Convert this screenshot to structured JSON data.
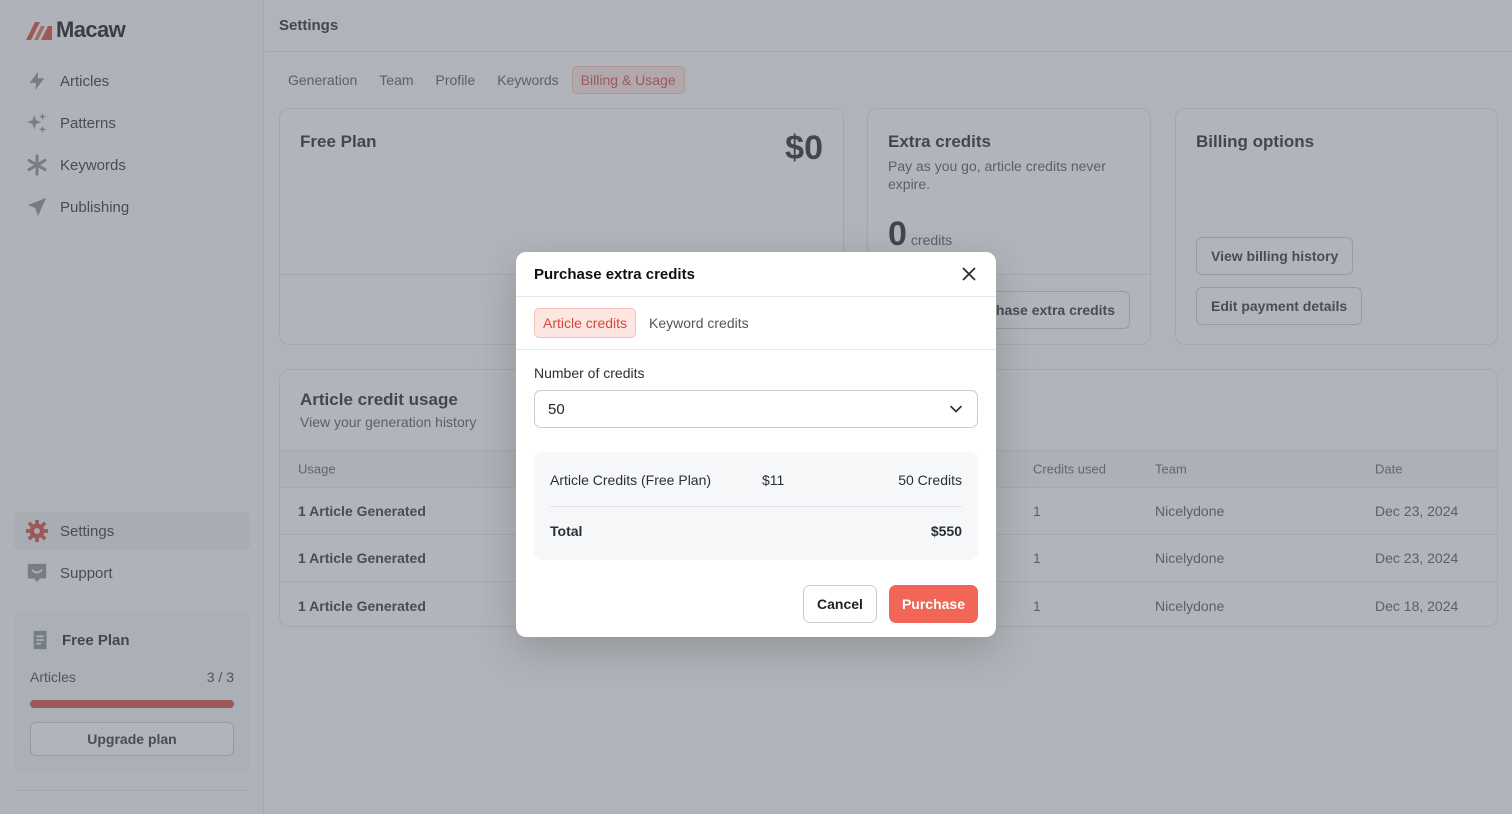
{
  "app": {
    "brand": "Macaw"
  },
  "sidebar": {
    "items": [
      {
        "label": "Articles",
        "icon": "lightning-icon"
      },
      {
        "label": "Patterns",
        "icon": "sparkles-icon"
      },
      {
        "label": "Keywords",
        "icon": "asterisk-icon"
      },
      {
        "label": "Publishing",
        "icon": "send-icon"
      }
    ],
    "settings_label": "Settings",
    "support_label": "Support",
    "plan": {
      "title": "Free Plan",
      "articles_label": "Articles",
      "articles_count": "3 / 3",
      "usage_fraction": 1.0,
      "upgrade_label": "Upgrade plan"
    }
  },
  "header": {
    "title": "Settings"
  },
  "tabs": [
    "Generation",
    "Team",
    "Profile",
    "Keywords",
    "Billing & Usage"
  ],
  "active_tab": "Billing & Usage",
  "cards": {
    "plan": {
      "title": "Free Plan",
      "price": "$0"
    },
    "extra": {
      "title": "Extra credits",
      "subtitle": "Pay as you go, article credits never expire.",
      "credits_value": "0",
      "credits_label": "credits",
      "button_label": "Purchase extra credits"
    },
    "billing": {
      "title": "Billing options",
      "history_label": "View billing history",
      "payment_label": "Edit payment details"
    }
  },
  "usage": {
    "title": "Article credit usage",
    "subtitle": "View your generation history",
    "columns": [
      "Usage",
      "Credits used",
      "Team",
      "Date"
    ],
    "rows": [
      {
        "usage": "1 Article Generated",
        "credits": "1",
        "team": "Nicelydone",
        "date": "Dec 23, 2024"
      },
      {
        "usage": "1 Article Generated",
        "credits": "1",
        "team": "Nicelydone",
        "date": "Dec 23, 2024"
      },
      {
        "usage": "1 Article Generated",
        "credits": "1",
        "team": "Nicelydone",
        "date": "Dec 18, 2024"
      }
    ]
  },
  "modal": {
    "title": "Purchase extra credits",
    "tabs": [
      "Article credits",
      "Keyword credits"
    ],
    "active_tab": "Article credits",
    "field_label": "Number of credits",
    "selected_value": "50",
    "summary": {
      "item_label": "Article Credits (Free Plan)",
      "item_price": "$11",
      "item_qty": "50 Credits",
      "total_label": "Total",
      "total_value": "$550"
    },
    "cancel_label": "Cancel",
    "purchase_label": "Purchase"
  },
  "colors": {
    "accent": "#f26657",
    "accent_dark": "#d24a3d",
    "overlay": "rgba(100,106,117,0.5)"
  }
}
